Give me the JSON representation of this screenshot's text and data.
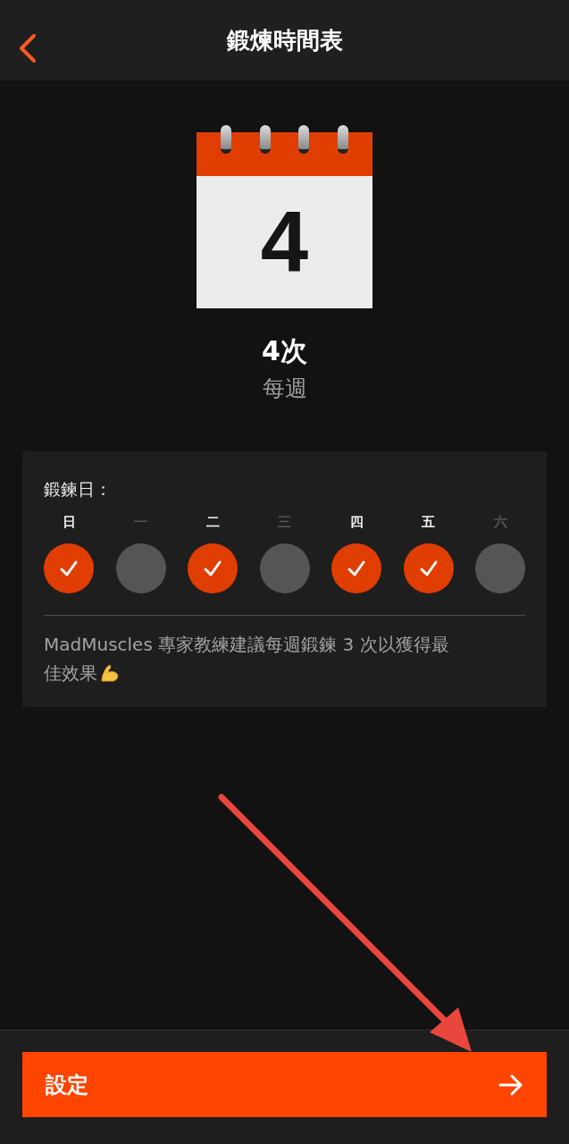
{
  "header": {
    "title": "鍛煉時間表"
  },
  "calendar": {
    "number": "4"
  },
  "frequency": {
    "count": "4次",
    "period": "每週"
  },
  "schedule": {
    "label": "鍛鍊日：",
    "days": [
      {
        "label": "日",
        "selected": true
      },
      {
        "label": "一",
        "selected": false
      },
      {
        "label": "二",
        "selected": true
      },
      {
        "label": "三",
        "selected": false
      },
      {
        "label": "四",
        "selected": true
      },
      {
        "label": "五",
        "selected": true
      },
      {
        "label": "六",
        "selected": false
      }
    ],
    "tip_lines": [
      "MadMuscles 專家教練建議每週鍛鍊 3 次以獲得最",
      "佳效果"
    ]
  },
  "button": {
    "label": "設定"
  }
}
